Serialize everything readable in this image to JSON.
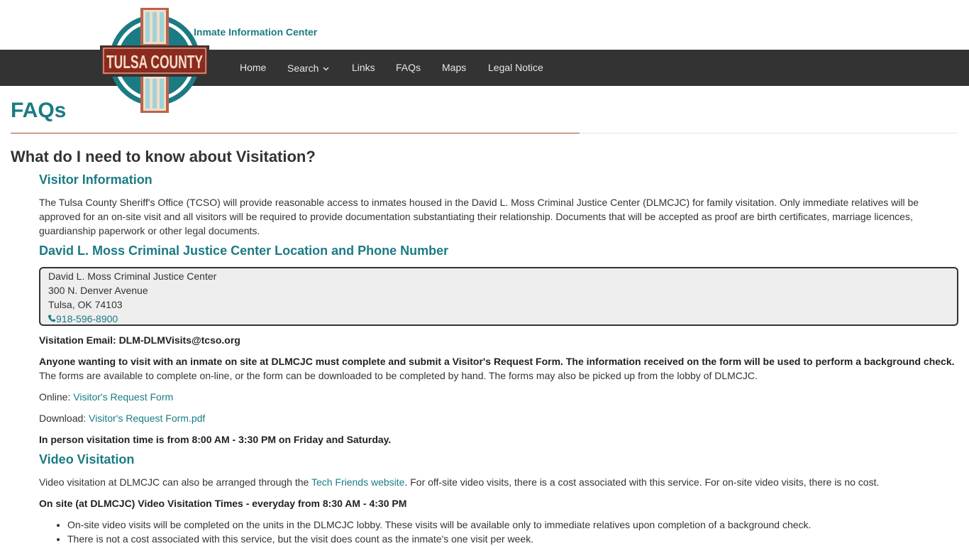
{
  "header": {
    "logo_text": "TULSA COUNTY",
    "subtitle": "Inmate Information Center"
  },
  "nav": {
    "items": [
      {
        "label": "Home"
      },
      {
        "label": "Search"
      },
      {
        "label": "Links"
      },
      {
        "label": "FAQs"
      },
      {
        "label": "Maps"
      },
      {
        "label": "Legal Notice"
      }
    ]
  },
  "page": {
    "title": "FAQs",
    "question": "What do I need to know about Visitation?"
  },
  "visitor_info": {
    "heading": "Visitor Information",
    "body": "The Tulsa County Sheriff's Office (TCSO) will provide reasonable access to inmates housed in the David L. Moss Criminal Justice Center (DLMCJC) for family visitation. Only immediate relatives will be approved for an on-site visit and all visitors will be required to provide documentation substantiating their relationship. Documents that will be accepted as proof are birth certificates, marriage licences, guardianship paperwork or other legal documents."
  },
  "location": {
    "heading": "David L. Moss Criminal Justice Center Location and Phone Number",
    "name": "David L. Moss Criminal Justice Center",
    "street": "300 N. Denver Avenue",
    "city": "Tulsa, OK 74103",
    "phone": "918-596-8900"
  },
  "email": {
    "label": "Visitation Email:",
    "address": "DLM-DLMVisits@tcso.org"
  },
  "request_form": {
    "bold_text": "Anyone wanting to visit with an inmate on site at DLMCJC must complete and submit a Visitor's Request Form. The information received on the form will be used to perform a background check.",
    "text": "The forms are available to complete on-line, or the form can be downloaded to be completed by hand. The forms may also be picked up from the lobby of DLMCJC.",
    "online_label": "Online:",
    "online_link": "Visitor's Request Form",
    "download_label": "Download:",
    "download_link": "Visitor's Request Form.pdf",
    "hours": "In person visitation time is from 8:00 AM - 3:30 PM on Friday and Saturday."
  },
  "video": {
    "heading": "Video Visitation",
    "text_before": "Video visitation at DLMCJC can also be arranged through the",
    "link": "Tech Friends website",
    "text_after": ". For off-site video visits, there is a cost associated with this service. For on-site video visits, there is no cost.",
    "times": "On site (at DLMCJC) Video Visitation Times - everyday from 8:30 AM - 4:30 PM",
    "bullets": [
      "On-site video visits will be completed on the units in the DLMCJC lobby. These visits will be available only to immediate relatives upon completion of a background check.",
      "There is not a cost associated with this service, but the visit does count as the inmate's one visit per week."
    ]
  },
  "colors": {
    "accent": "#1b7b83",
    "navbar": "#333333",
    "rule": "#a0522d",
    "box_bg": "#eeeeee"
  }
}
